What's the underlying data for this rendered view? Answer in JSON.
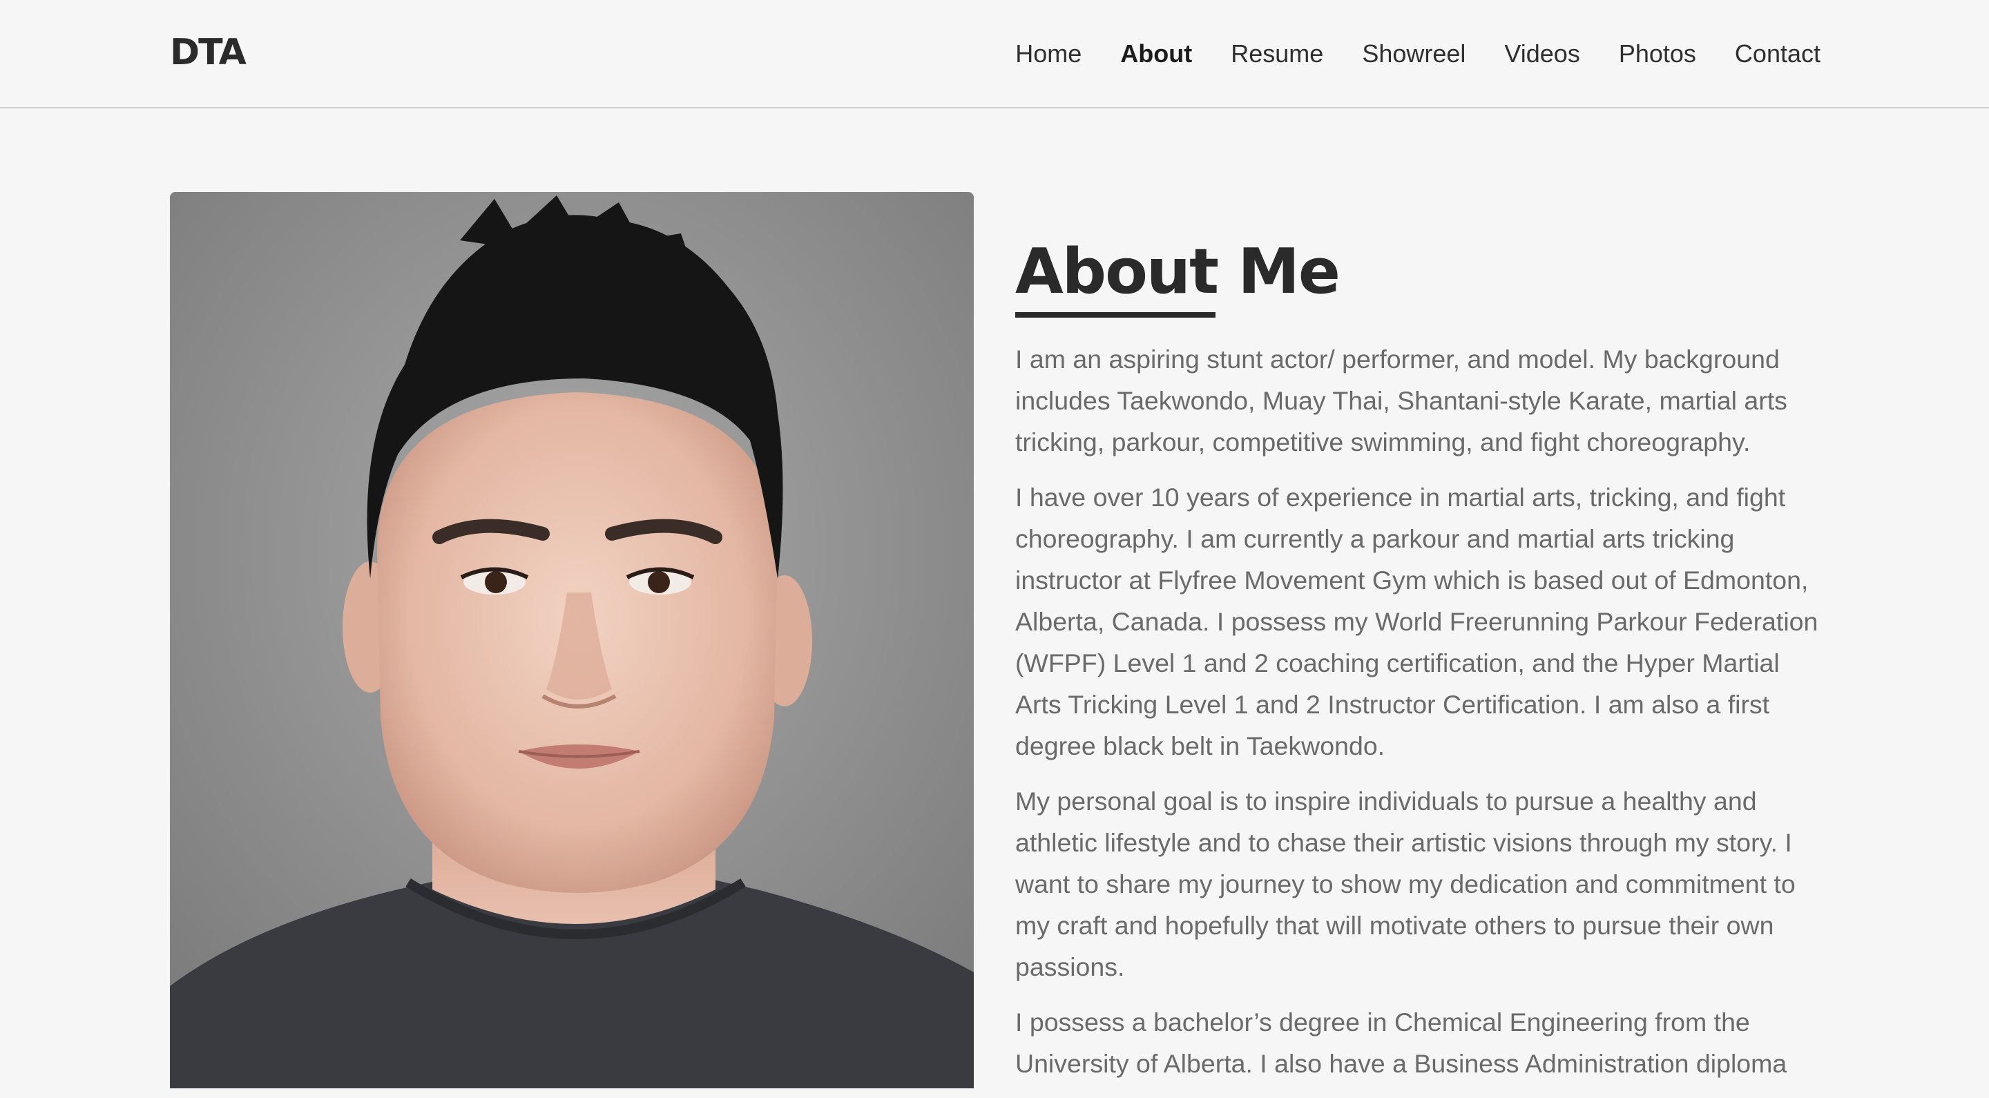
{
  "header": {
    "logo": "DTA",
    "nav": [
      {
        "label": "Home",
        "active": false
      },
      {
        "label": "About",
        "active": true
      },
      {
        "label": "Resume",
        "active": false
      },
      {
        "label": "Showreel",
        "active": false
      },
      {
        "label": "Videos",
        "active": false
      },
      {
        "label": "Photos",
        "active": false
      },
      {
        "label": "Contact",
        "active": false
      }
    ]
  },
  "about": {
    "title": "About Me",
    "paragraphs": [
      "I am an aspiring stunt actor/ performer, and model. My background includes Taekwondo, Muay Thai, Shantani-style Karate, martial arts tricking, parkour, competitive swimming, and fight choreography.",
      "I have over 10 years of experience in martial arts, tricking, and fight choreography. I am currently a parkour and martial arts tricking instructor at Flyfree Movement Gym which is based out of Edmonton, Alberta, Canada. I possess my World Freerunning Parkour Federation (WFPF) Level 1 and 2 coaching certification, and the Hyper Martial Arts Tricking Level 1 and 2 Instructor Certification. I am also a first degree black belt in Taekwondo.",
      "My personal goal is to inspire individuals to pursue a healthy and athletic lifestyle and to chase their artistic visions through my story. I want to share my journey to show my dedication and commitment to my craft and hopefully that will motivate others to pursue their own passions.",
      "I possess a bachelor’s degree in Chemical Engineering from the University of Alberta. I also have a Business Administration diploma"
    ]
  },
  "photo": {
    "subject": "headshot-portrait"
  },
  "colors": {
    "background": "#f6f6f6",
    "heading": "#2a2a2a",
    "body_text": "#6a6a6a",
    "nav_text": "#2f2f2f"
  }
}
